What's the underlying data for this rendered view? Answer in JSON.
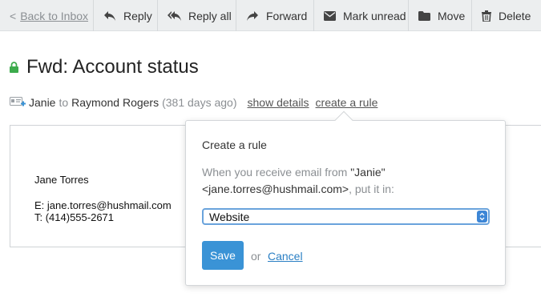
{
  "toolbar": {
    "back_label": "Back to Inbox",
    "reply_label": "Reply",
    "reply_all_label": "Reply all",
    "forward_label": "Forward",
    "mark_unread_label": "Mark unread",
    "move_label": "Move",
    "delete_label": "Delete"
  },
  "message": {
    "subject": "Fwd: Account status",
    "from_name": "Janie",
    "to_word": "to",
    "to_name": "Raymond Rogers",
    "age": "(381 days ago)",
    "show_details_label": "show details",
    "create_rule_label": "create a rule",
    "signature": {
      "name": "Jane Torres",
      "email_line": "E: jane.torres@hushmail.com",
      "phone_line": "T: (414)555-2671"
    }
  },
  "rule_popover": {
    "title": "Create a rule",
    "desc_prefix": "When you receive email from ",
    "sender_quoted": "\"Janie\"",
    "sender_email": "<jane.torres@hushmail.com>",
    "desc_suffix": ", put it in:",
    "folder_selected": "Website",
    "save_label": "Save",
    "or_label": "or",
    "cancel_label": "Cancel"
  },
  "colors": {
    "toolbar_bg": "#eceeef",
    "primary_button": "#3a93d6",
    "link": "#2a7fc4",
    "lock_green": "#3cab4c"
  }
}
